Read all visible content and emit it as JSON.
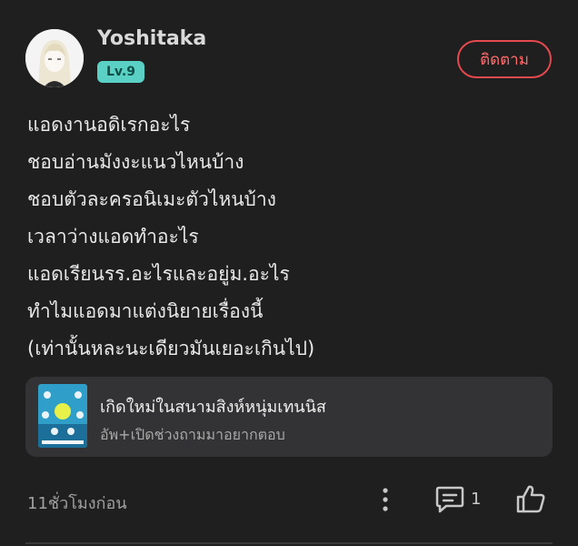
{
  "author": {
    "name": "Yoshitaka",
    "level": "Lv.9",
    "follow_label": "ติดตาม"
  },
  "post": {
    "lines": [
      "แอดงานอดิเรกอะไร",
      "ชอบอ่านมังงะแนวไหนบ้าง",
      "ชอบตัวละครอนิเมะตัวไหนบ้าง",
      "เวลาว่างแอดทำอะไร",
      "แอดเรียนรร.อะไรและอยู่ม.อะไร",
      "ทำไมแอดมาแต่งนิยายเรื่องนี้",
      "(เท่านั้นหละนะเดียวมันเยอะเกินไป)"
    ]
  },
  "linked_story": {
    "title": "เกิดใหม่ในสนามสิงห์หนุ่มเทนนิส",
    "subtitle": "อัพ+เปิดช่วงถามมาอยากตอบ"
  },
  "footer": {
    "time": "11ชั่วโมงก่อน",
    "comment_count": "1"
  },
  "icons": {
    "more": "more-vertical-icon",
    "comment": "comment-icon",
    "like": "thumbs-up-icon"
  },
  "colors": {
    "accent": "#e5484d",
    "level_badge": "#5ad1c4",
    "background": "#1f1f1f",
    "card": "#333335"
  }
}
